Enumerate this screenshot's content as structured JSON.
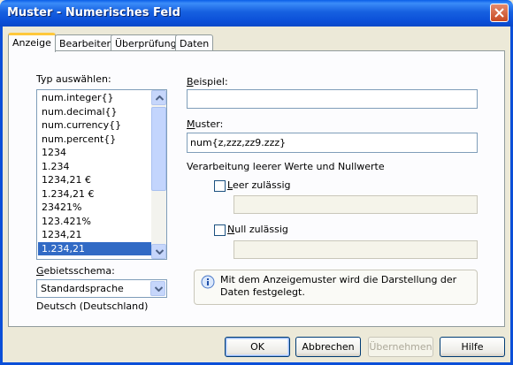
{
  "window": {
    "title": "Muster - Numerisches Feld"
  },
  "tabs": [
    {
      "label": "Anzeige",
      "active": true
    },
    {
      "label": "Bearbeiten",
      "active": false
    },
    {
      "label": "Überprüfung",
      "active": false
    },
    {
      "label": "Daten",
      "active": false
    }
  ],
  "type_section": {
    "label": "Typ auswählen:",
    "items": [
      "num.integer{}",
      "num.decimal{}",
      "num.currency{}",
      "num.percent{}",
      "1234",
      "1.234",
      "1234,21 €",
      "1.234,21 €",
      "23421%",
      "123.421%",
      "1234,21",
      "1.234,21"
    ],
    "selected_index": 11
  },
  "locale": {
    "label": "Gebietsschema:",
    "selected": "Standardsprache",
    "description": "Deutsch (Deutschland)"
  },
  "example": {
    "label": "Beispiel:",
    "value": ""
  },
  "pattern": {
    "label": "Muster:",
    "value": "num{z,zzz,zz9.zzz}"
  },
  "empty_values": {
    "heading": "Verarbeitung leerer Werte und Nullwerte",
    "empty_checkbox_label": "Leer zulässig",
    "empty_value": "",
    "null_checkbox_label": "Null zulässig",
    "null_value": ""
  },
  "info": {
    "text": "Mit dem Anzeigemuster wird die Darstellung der Daten festgelegt.",
    "icon": "info-icon"
  },
  "buttons": {
    "ok": "OK",
    "cancel": "Abbrechen",
    "apply": "Übernehmen",
    "help": "Hilfe"
  },
  "colors": {
    "titlebar": "#0b4fd8",
    "selection": "#316ac5",
    "dialog_bg": "#ece9d8"
  }
}
